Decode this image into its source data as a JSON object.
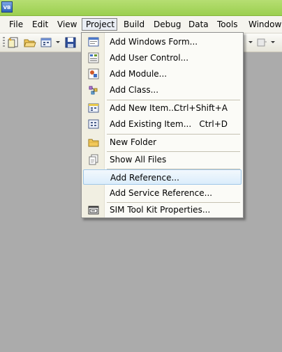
{
  "window": {
    "icon_text": "VB"
  },
  "menubar": {
    "items": [
      {
        "label": "File"
      },
      {
        "label": "Edit"
      },
      {
        "label": "View"
      },
      {
        "label": "Project"
      },
      {
        "label": "Build"
      },
      {
        "label": "Debug"
      },
      {
        "label": "Data"
      },
      {
        "label": "Tools"
      },
      {
        "label": "Window"
      }
    ]
  },
  "project_menu": {
    "items": [
      {
        "label": "Add Windows Form...",
        "icon": "windows-form-icon"
      },
      {
        "label": "Add User Control...",
        "icon": "user-control-icon"
      },
      {
        "label": "Add Module...",
        "icon": "module-icon"
      },
      {
        "label": "Add Class...",
        "icon": "class-icon"
      },
      {
        "label": "Add New Item...",
        "shortcut": "Ctrl+Shift+A",
        "icon": "new-item-icon"
      },
      {
        "label": "Add Existing Item...",
        "shortcut": "Ctrl+D",
        "icon": "existing-item-icon"
      },
      {
        "label": "New Folder",
        "icon": "folder-icon"
      },
      {
        "label": "Show All Files",
        "icon": "show-all-files-icon"
      },
      {
        "label": "Add Reference...",
        "highlighted": true
      },
      {
        "label": "Add Service Reference..."
      },
      {
        "label": "SIM Tool Kit Properties...",
        "icon": "properties-icon"
      }
    ]
  },
  "colors": {
    "titlebar": "#9bcf4f",
    "background": "#ababab",
    "menu_highlight": "#dbedfb"
  }
}
